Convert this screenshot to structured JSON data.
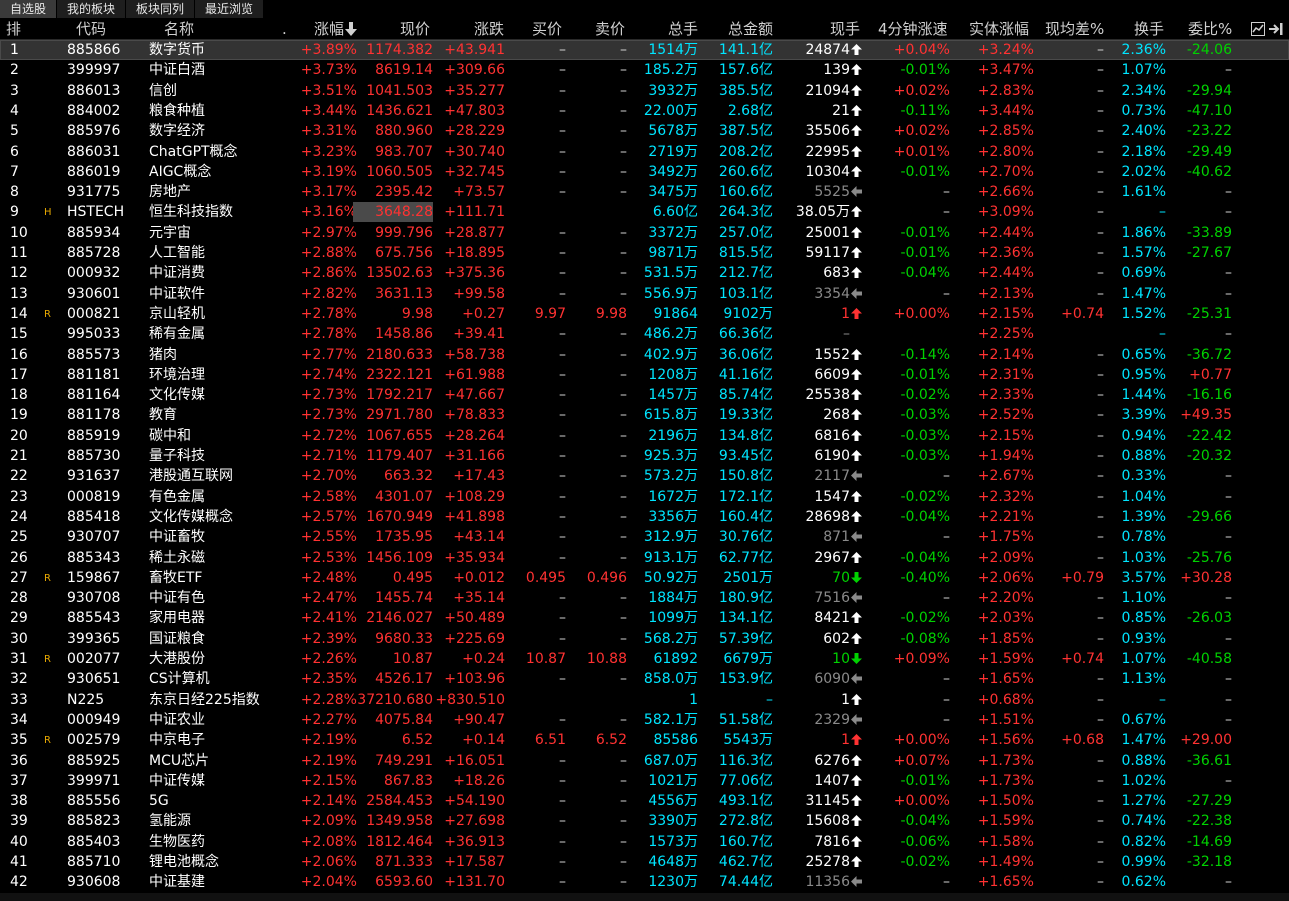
{
  "tabs": [
    "自选股",
    "我的板块",
    "板块同列",
    "最近浏览"
  ],
  "active_tab": 0,
  "columns": {
    "rank": "排",
    "code": "代码",
    "name": "名称",
    "dot": ".",
    "pct": "涨幅",
    "price": "现价",
    "change": "涨跌",
    "bid": "买价",
    "ask": "卖价",
    "volume": "总手",
    "amount": "总金额",
    "cur_vol": "现手",
    "speed": "4分钟涨速",
    "body_pct": "实体涨幅",
    "avg_diff": "现均差%",
    "turnover": "换手",
    "commit": "委比%"
  },
  "icons": {
    "settings": "gear-icon",
    "sort": "sort-down-arrow-icon",
    "chart": "chart-icon",
    "exit": "exit-icon"
  },
  "colors": {
    "up": "#ff3232",
    "down": "#00d200",
    "volume": "#00e5ff",
    "neutral": "#d0d0d0",
    "mark": "#e8a800"
  },
  "rows": [
    {
      "n": "1",
      "mark": "",
      "code": "885866",
      "name": "数字货币",
      "pct": "+3.89%",
      "price": "1174.382",
      "chg": "+43.941",
      "bid": "–",
      "ask": "–",
      "vol": "1514万",
      "amt": "141.1亿",
      "cur": "24874",
      "dir": "up",
      "speed": "+0.04%",
      "body": "+3.24%",
      "avg": "–",
      "turn": "2.36%",
      "commit": "-24.06",
      "sel": true
    },
    {
      "n": "2",
      "mark": "",
      "code": "399997",
      "name": "中证白酒",
      "pct": "+3.73%",
      "price": "8619.14",
      "chg": "+309.66",
      "bid": "–",
      "ask": "–",
      "vol": "185.2万",
      "amt": "157.6亿",
      "cur": "139",
      "dir": "up",
      "speed": "-0.01%",
      "body": "+3.47%",
      "avg": "–",
      "turn": "1.07%",
      "commit": "–"
    },
    {
      "n": "3",
      "mark": "",
      "code": "886013",
      "name": "信创",
      "pct": "+3.51%",
      "price": "1041.503",
      "chg": "+35.277",
      "bid": "–",
      "ask": "–",
      "vol": "3932万",
      "amt": "385.5亿",
      "cur": "21094",
      "dir": "up",
      "speed": "+0.02%",
      "body": "+2.83%",
      "avg": "–",
      "turn": "2.34%",
      "commit": "-29.94"
    },
    {
      "n": "4",
      "mark": "",
      "code": "884002",
      "name": "粮食种植",
      "pct": "+3.44%",
      "price": "1436.621",
      "chg": "+47.803",
      "bid": "–",
      "ask": "–",
      "vol": "22.00万",
      "amt": "2.68亿",
      "cur": "21",
      "dir": "up",
      "speed": "-0.11%",
      "body": "+3.44%",
      "avg": "–",
      "turn": "0.73%",
      "commit": "-47.10"
    },
    {
      "n": "5",
      "mark": "",
      "code": "885976",
      "name": "数字经济",
      "pct": "+3.31%",
      "price": "880.960",
      "chg": "+28.229",
      "bid": "–",
      "ask": "–",
      "vol": "5678万",
      "amt": "387.5亿",
      "cur": "35506",
      "dir": "up",
      "speed": "+0.02%",
      "body": "+2.85%",
      "avg": "–",
      "turn": "2.40%",
      "commit": "-23.22"
    },
    {
      "n": "6",
      "mark": "",
      "code": "886031",
      "name": "ChatGPT概念",
      "pct": "+3.23%",
      "price": "983.707",
      "chg": "+30.740",
      "bid": "–",
      "ask": "–",
      "vol": "2719万",
      "amt": "208.2亿",
      "cur": "22995",
      "dir": "up",
      "speed": "+0.01%",
      "body": "+2.80%",
      "avg": "–",
      "turn": "2.18%",
      "commit": "-29.49"
    },
    {
      "n": "7",
      "mark": "",
      "code": "886019",
      "name": "AIGC概念",
      "pct": "+3.19%",
      "price": "1060.505",
      "chg": "+32.745",
      "bid": "–",
      "ask": "–",
      "vol": "3492万",
      "amt": "260.6亿",
      "cur": "10304",
      "dir": "up",
      "speed": "-0.01%",
      "body": "+2.70%",
      "avg": "–",
      "turn": "2.02%",
      "commit": "-40.62"
    },
    {
      "n": "8",
      "mark": "",
      "code": "931775",
      "name": "房地产",
      "pct": "+3.17%",
      "price": "2395.42",
      "chg": "+73.57",
      "bid": "–",
      "ask": "–",
      "vol": "3475万",
      "amt": "160.6亿",
      "cur": "5525",
      "dir": "left",
      "speed": "–",
      "body": "+2.66%",
      "avg": "–",
      "turn": "1.61%",
      "commit": "–"
    },
    {
      "n": "9",
      "mark": "H",
      "code": "HSTECH",
      "name": "恒生科技指数",
      "pct": "+3.16%",
      "price": "3648.28",
      "chg": "+111.71",
      "bid": "",
      "ask": "",
      "vol": "6.60亿",
      "amt": "264.3亿",
      "cur": "38.05万",
      "dir": "up",
      "speed": "–",
      "body": "+3.09%",
      "avg": "–",
      "turn": "–",
      "commit": "–",
      "hilite": true
    },
    {
      "n": "10",
      "mark": "",
      "code": "885934",
      "name": "元宇宙",
      "pct": "+2.97%",
      "price": "999.796",
      "chg": "+28.877",
      "bid": "–",
      "ask": "–",
      "vol": "3372万",
      "amt": "257.0亿",
      "cur": "25001",
      "dir": "up",
      "speed": "-0.01%",
      "body": "+2.44%",
      "avg": "–",
      "turn": "1.86%",
      "commit": "-33.89"
    },
    {
      "n": "11",
      "mark": "",
      "code": "885728",
      "name": "人工智能",
      "pct": "+2.88%",
      "price": "675.756",
      "chg": "+18.895",
      "bid": "–",
      "ask": "–",
      "vol": "9871万",
      "amt": "815.5亿",
      "cur": "59117",
      "dir": "up",
      "speed": "-0.01%",
      "body": "+2.36%",
      "avg": "–",
      "turn": "1.57%",
      "commit": "-27.67"
    },
    {
      "n": "12",
      "mark": "",
      "code": "000932",
      "name": "中证消费",
      "pct": "+2.86%",
      "price": "13502.63",
      "chg": "+375.36",
      "bid": "–",
      "ask": "–",
      "vol": "531.5万",
      "amt": "212.7亿",
      "cur": "683",
      "dir": "up",
      "speed": "-0.04%",
      "body": "+2.44%",
      "avg": "–",
      "turn": "0.69%",
      "commit": "–"
    },
    {
      "n": "13",
      "mark": "",
      "code": "930601",
      "name": "中证软件",
      "pct": "+2.82%",
      "price": "3631.13",
      "chg": "+99.58",
      "bid": "–",
      "ask": "–",
      "vol": "556.9万",
      "amt": "103.1亿",
      "cur": "3354",
      "dir": "left",
      "speed": "–",
      "body": "+2.13%",
      "avg": "–",
      "turn": "1.47%",
      "commit": "–"
    },
    {
      "n": "14",
      "mark": "R",
      "code": "000821",
      "name": "京山轻机",
      "pct": "+2.78%",
      "price": "9.98",
      "chg": "+0.27",
      "bid": "9.97",
      "ask": "9.98",
      "vol": "91864",
      "amt": "9102万",
      "cur": "1",
      "dir": "redup",
      "speed": "+0.00%",
      "body": "+2.15%",
      "avg": "+0.74",
      "turn": "1.52%",
      "commit": "-25.31"
    },
    {
      "n": "15",
      "mark": "",
      "code": "995033",
      "name": "稀有金属",
      "pct": "+2.78%",
      "price": "1458.86",
      "chg": "+39.41",
      "bid": "–",
      "ask": "–",
      "vol": "486.2万",
      "amt": "66.36亿",
      "cur": "–",
      "dir": "none",
      "speed": "",
      "body": "+2.25%",
      "avg": "",
      "turn": "–",
      "commit": "–"
    },
    {
      "n": "16",
      "mark": "",
      "code": "885573",
      "name": "猪肉",
      "pct": "+2.77%",
      "price": "2180.633",
      "chg": "+58.738",
      "bid": "–",
      "ask": "–",
      "vol": "402.9万",
      "amt": "36.06亿",
      "cur": "1552",
      "dir": "up",
      "speed": "-0.14%",
      "body": "+2.14%",
      "avg": "–",
      "turn": "0.65%",
      "commit": "-36.72"
    },
    {
      "n": "17",
      "mark": "",
      "code": "881181",
      "name": "环境治理",
      "pct": "+2.74%",
      "price": "2322.121",
      "chg": "+61.988",
      "bid": "–",
      "ask": "–",
      "vol": "1208万",
      "amt": "41.16亿",
      "cur": "6609",
      "dir": "up",
      "speed": "-0.01%",
      "body": "+2.31%",
      "avg": "–",
      "turn": "0.95%",
      "commit": "+0.77"
    },
    {
      "n": "18",
      "mark": "",
      "code": "881164",
      "name": "文化传媒",
      "pct": "+2.73%",
      "price": "1792.217",
      "chg": "+47.667",
      "bid": "–",
      "ask": "–",
      "vol": "1457万",
      "amt": "85.74亿",
      "cur": "25538",
      "dir": "up",
      "speed": "-0.02%",
      "body": "+2.33%",
      "avg": "–",
      "turn": "1.44%",
      "commit": "-16.16"
    },
    {
      "n": "19",
      "mark": "",
      "code": "881178",
      "name": "教育",
      "pct": "+2.73%",
      "price": "2971.780",
      "chg": "+78.833",
      "bid": "–",
      "ask": "–",
      "vol": "615.8万",
      "amt": "19.33亿",
      "cur": "268",
      "dir": "up",
      "speed": "-0.03%",
      "body": "+2.52%",
      "avg": "–",
      "turn": "3.39%",
      "commit": "+49.35"
    },
    {
      "n": "20",
      "mark": "",
      "code": "885919",
      "name": "碳中和",
      "pct": "+2.72%",
      "price": "1067.655",
      "chg": "+28.264",
      "bid": "–",
      "ask": "–",
      "vol": "2196万",
      "amt": "134.8亿",
      "cur": "6816",
      "dir": "up",
      "speed": "-0.03%",
      "body": "+2.15%",
      "avg": "–",
      "turn": "0.94%",
      "commit": "-22.42"
    },
    {
      "n": "21",
      "mark": "",
      "code": "885730",
      "name": "量子科技",
      "pct": "+2.71%",
      "price": "1179.407",
      "chg": "+31.166",
      "bid": "–",
      "ask": "–",
      "vol": "925.3万",
      "amt": "93.45亿",
      "cur": "6190",
      "dir": "up",
      "speed": "-0.03%",
      "body": "+1.94%",
      "avg": "–",
      "turn": "0.88%",
      "commit": "-20.32"
    },
    {
      "n": "22",
      "mark": "",
      "code": "931637",
      "name": "港股通互联网",
      "pct": "+2.70%",
      "price": "663.32",
      "chg": "+17.43",
      "bid": "–",
      "ask": "–",
      "vol": "573.2万",
      "amt": "150.8亿",
      "cur": "2117",
      "dir": "left",
      "speed": "–",
      "body": "+2.67%",
      "avg": "–",
      "turn": "0.33%",
      "commit": "–"
    },
    {
      "n": "23",
      "mark": "",
      "code": "000819",
      "name": "有色金属",
      "pct": "+2.58%",
      "price": "4301.07",
      "chg": "+108.29",
      "bid": "–",
      "ask": "–",
      "vol": "1672万",
      "amt": "172.1亿",
      "cur": "1547",
      "dir": "up",
      "speed": "-0.02%",
      "body": "+2.32%",
      "avg": "–",
      "turn": "1.04%",
      "commit": "–"
    },
    {
      "n": "24",
      "mark": "",
      "code": "885418",
      "name": "文化传媒概念",
      "pct": "+2.57%",
      "price": "1670.949",
      "chg": "+41.898",
      "bid": "–",
      "ask": "–",
      "vol": "3356万",
      "amt": "160.4亿",
      "cur": "28698",
      "dir": "up",
      "speed": "-0.04%",
      "body": "+2.21%",
      "avg": "–",
      "turn": "1.39%",
      "commit": "-29.66"
    },
    {
      "n": "25",
      "mark": "",
      "code": "930707",
      "name": "中证畜牧",
      "pct": "+2.55%",
      "price": "1735.95",
      "chg": "+43.14",
      "bid": "–",
      "ask": "–",
      "vol": "312.9万",
      "amt": "30.76亿",
      "cur": "871",
      "dir": "left",
      "speed": "–",
      "body": "+1.75%",
      "avg": "–",
      "turn": "0.78%",
      "commit": "–"
    },
    {
      "n": "26",
      "mark": "",
      "code": "885343",
      "name": "稀土永磁",
      "pct": "+2.53%",
      "price": "1456.109",
      "chg": "+35.934",
      "bid": "–",
      "ask": "–",
      "vol": "913.1万",
      "amt": "62.77亿",
      "cur": "2967",
      "dir": "up",
      "speed": "-0.04%",
      "body": "+2.09%",
      "avg": "–",
      "turn": "1.03%",
      "commit": "-25.76"
    },
    {
      "n": "27",
      "mark": "R",
      "code": "159867",
      "name": "畜牧ETF",
      "pct": "+2.48%",
      "price": "0.495",
      "chg": "+0.012",
      "bid": "0.495",
      "ask": "0.496",
      "vol": "50.92万",
      "amt": "2501万",
      "cur": "70",
      "dir": "greendown",
      "speed": "-0.40%",
      "body": "+2.06%",
      "avg": "+0.79",
      "turn": "3.57%",
      "commit": "+30.28"
    },
    {
      "n": "28",
      "mark": "",
      "code": "930708",
      "name": "中证有色",
      "pct": "+2.47%",
      "price": "1455.74",
      "chg": "+35.14",
      "bid": "–",
      "ask": "–",
      "vol": "1884万",
      "amt": "180.9亿",
      "cur": "7516",
      "dir": "left",
      "speed": "–",
      "body": "+2.20%",
      "avg": "–",
      "turn": "1.10%",
      "commit": "–"
    },
    {
      "n": "29",
      "mark": "",
      "code": "885543",
      "name": "家用电器",
      "pct": "+2.41%",
      "price": "2146.027",
      "chg": "+50.489",
      "bid": "–",
      "ask": "–",
      "vol": "1099万",
      "amt": "134.1亿",
      "cur": "8421",
      "dir": "up",
      "speed": "-0.02%",
      "body": "+2.03%",
      "avg": "–",
      "turn": "0.85%",
      "commit": "-26.03"
    },
    {
      "n": "30",
      "mark": "",
      "code": "399365",
      "name": "国证粮食",
      "pct": "+2.39%",
      "price": "9680.33",
      "chg": "+225.69",
      "bid": "–",
      "ask": "–",
      "vol": "568.2万",
      "amt": "57.39亿",
      "cur": "602",
      "dir": "up",
      "speed": "-0.08%",
      "body": "+1.85%",
      "avg": "–",
      "turn": "0.93%",
      "commit": "–"
    },
    {
      "n": "31",
      "mark": "R",
      "code": "002077",
      "name": "大港股份",
      "pct": "+2.26%",
      "price": "10.87",
      "chg": "+0.24",
      "bid": "10.87",
      "ask": "10.88",
      "vol": "61892",
      "amt": "6679万",
      "cur": "10",
      "dir": "greendown",
      "speed": "+0.09%",
      "body": "+1.59%",
      "avg": "+0.74",
      "turn": "1.07%",
      "commit": "-40.58"
    },
    {
      "n": "32",
      "mark": "",
      "code": "930651",
      "name": "CS计算机",
      "pct": "+2.35%",
      "price": "4526.17",
      "chg": "+103.96",
      "bid": "–",
      "ask": "–",
      "vol": "858.0万",
      "amt": "153.9亿",
      "cur": "6090",
      "dir": "left",
      "speed": "–",
      "body": "+1.65%",
      "avg": "–",
      "turn": "1.13%",
      "commit": "–"
    },
    {
      "n": "33",
      "mark": "",
      "code": "N225",
      "name": "东京日经225指数",
      "pct": "+2.28%",
      "price": "37210.680",
      "chg": "+830.510",
      "bid": "",
      "ask": "",
      "vol": "1",
      "amt": "–",
      "cur": "1",
      "dir": "up",
      "speed": "–",
      "body": "+0.68%",
      "avg": "–",
      "turn": "–",
      "commit": "–"
    },
    {
      "n": "34",
      "mark": "",
      "code": "000949",
      "name": "中证农业",
      "pct": "+2.27%",
      "price": "4075.84",
      "chg": "+90.47",
      "bid": "–",
      "ask": "–",
      "vol": "582.1万",
      "amt": "51.58亿",
      "cur": "2329",
      "dir": "left",
      "speed": "–",
      "body": "+1.51%",
      "avg": "–",
      "turn": "0.67%",
      "commit": "–"
    },
    {
      "n": "35",
      "mark": "R",
      "code": "002579",
      "name": "中京电子",
      "pct": "+2.19%",
      "price": "6.52",
      "chg": "+0.14",
      "bid": "6.51",
      "ask": "6.52",
      "vol": "85586",
      "amt": "5543万",
      "cur": "1",
      "dir": "redup",
      "speed": "+0.00%",
      "body": "+1.56%",
      "avg": "+0.68",
      "turn": "1.47%",
      "commit": "+29.00"
    },
    {
      "n": "36",
      "mark": "",
      "code": "885925",
      "name": "MCU芯片",
      "pct": "+2.19%",
      "price": "749.291",
      "chg": "+16.051",
      "bid": "–",
      "ask": "–",
      "vol": "687.0万",
      "amt": "116.3亿",
      "cur": "6276",
      "dir": "up",
      "speed": "+0.07%",
      "body": "+1.73%",
      "avg": "–",
      "turn": "0.88%",
      "commit": "-36.61"
    },
    {
      "n": "37",
      "mark": "",
      "code": "399971",
      "name": "中证传媒",
      "pct": "+2.15%",
      "price": "867.83",
      "chg": "+18.26",
      "bid": "–",
      "ask": "–",
      "vol": "1021万",
      "amt": "77.06亿",
      "cur": "1407",
      "dir": "up",
      "speed": "-0.01%",
      "body": "+1.73%",
      "avg": "–",
      "turn": "1.02%",
      "commit": "–"
    },
    {
      "n": "38",
      "mark": "",
      "code": "885556",
      "name": "5G",
      "pct": "+2.14%",
      "price": "2584.453",
      "chg": "+54.190",
      "bid": "–",
      "ask": "–",
      "vol": "4556万",
      "amt": "493.1亿",
      "cur": "31145",
      "dir": "up",
      "speed": "+0.00%",
      "body": "+1.50%",
      "avg": "–",
      "turn": "1.27%",
      "commit": "-27.29"
    },
    {
      "n": "39",
      "mark": "",
      "code": "885823",
      "name": "氢能源",
      "pct": "+2.09%",
      "price": "1349.958",
      "chg": "+27.698",
      "bid": "–",
      "ask": "–",
      "vol": "3390万",
      "amt": "272.8亿",
      "cur": "15608",
      "dir": "up",
      "speed": "-0.04%",
      "body": "+1.59%",
      "avg": "–",
      "turn": "0.74%",
      "commit": "-22.38"
    },
    {
      "n": "40",
      "mark": "",
      "code": "885403",
      "name": "生物医药",
      "pct": "+2.08%",
      "price": "1812.464",
      "chg": "+36.913",
      "bid": "–",
      "ask": "–",
      "vol": "1573万",
      "amt": "160.7亿",
      "cur": "7816",
      "dir": "up",
      "speed": "-0.06%",
      "body": "+1.58%",
      "avg": "–",
      "turn": "0.82%",
      "commit": "-14.69"
    },
    {
      "n": "41",
      "mark": "",
      "code": "885710",
      "name": "锂电池概念",
      "pct": "+2.06%",
      "price": "871.333",
      "chg": "+17.587",
      "bid": "–",
      "ask": "–",
      "vol": "4648万",
      "amt": "462.7亿",
      "cur": "25278",
      "dir": "up",
      "speed": "-0.02%",
      "body": "+1.49%",
      "avg": "–",
      "turn": "0.99%",
      "commit": "-32.18"
    },
    {
      "n": "42",
      "mark": "",
      "code": "930608",
      "name": "中证基建",
      "pct": "+2.04%",
      "price": "6593.60",
      "chg": "+131.70",
      "bid": "–",
      "ask": "–",
      "vol": "1230万",
      "amt": "74.44亿",
      "cur": "11356",
      "dir": "left",
      "speed": "–",
      "body": "+1.65%",
      "avg": "–",
      "turn": "0.62%",
      "commit": "–"
    }
  ]
}
